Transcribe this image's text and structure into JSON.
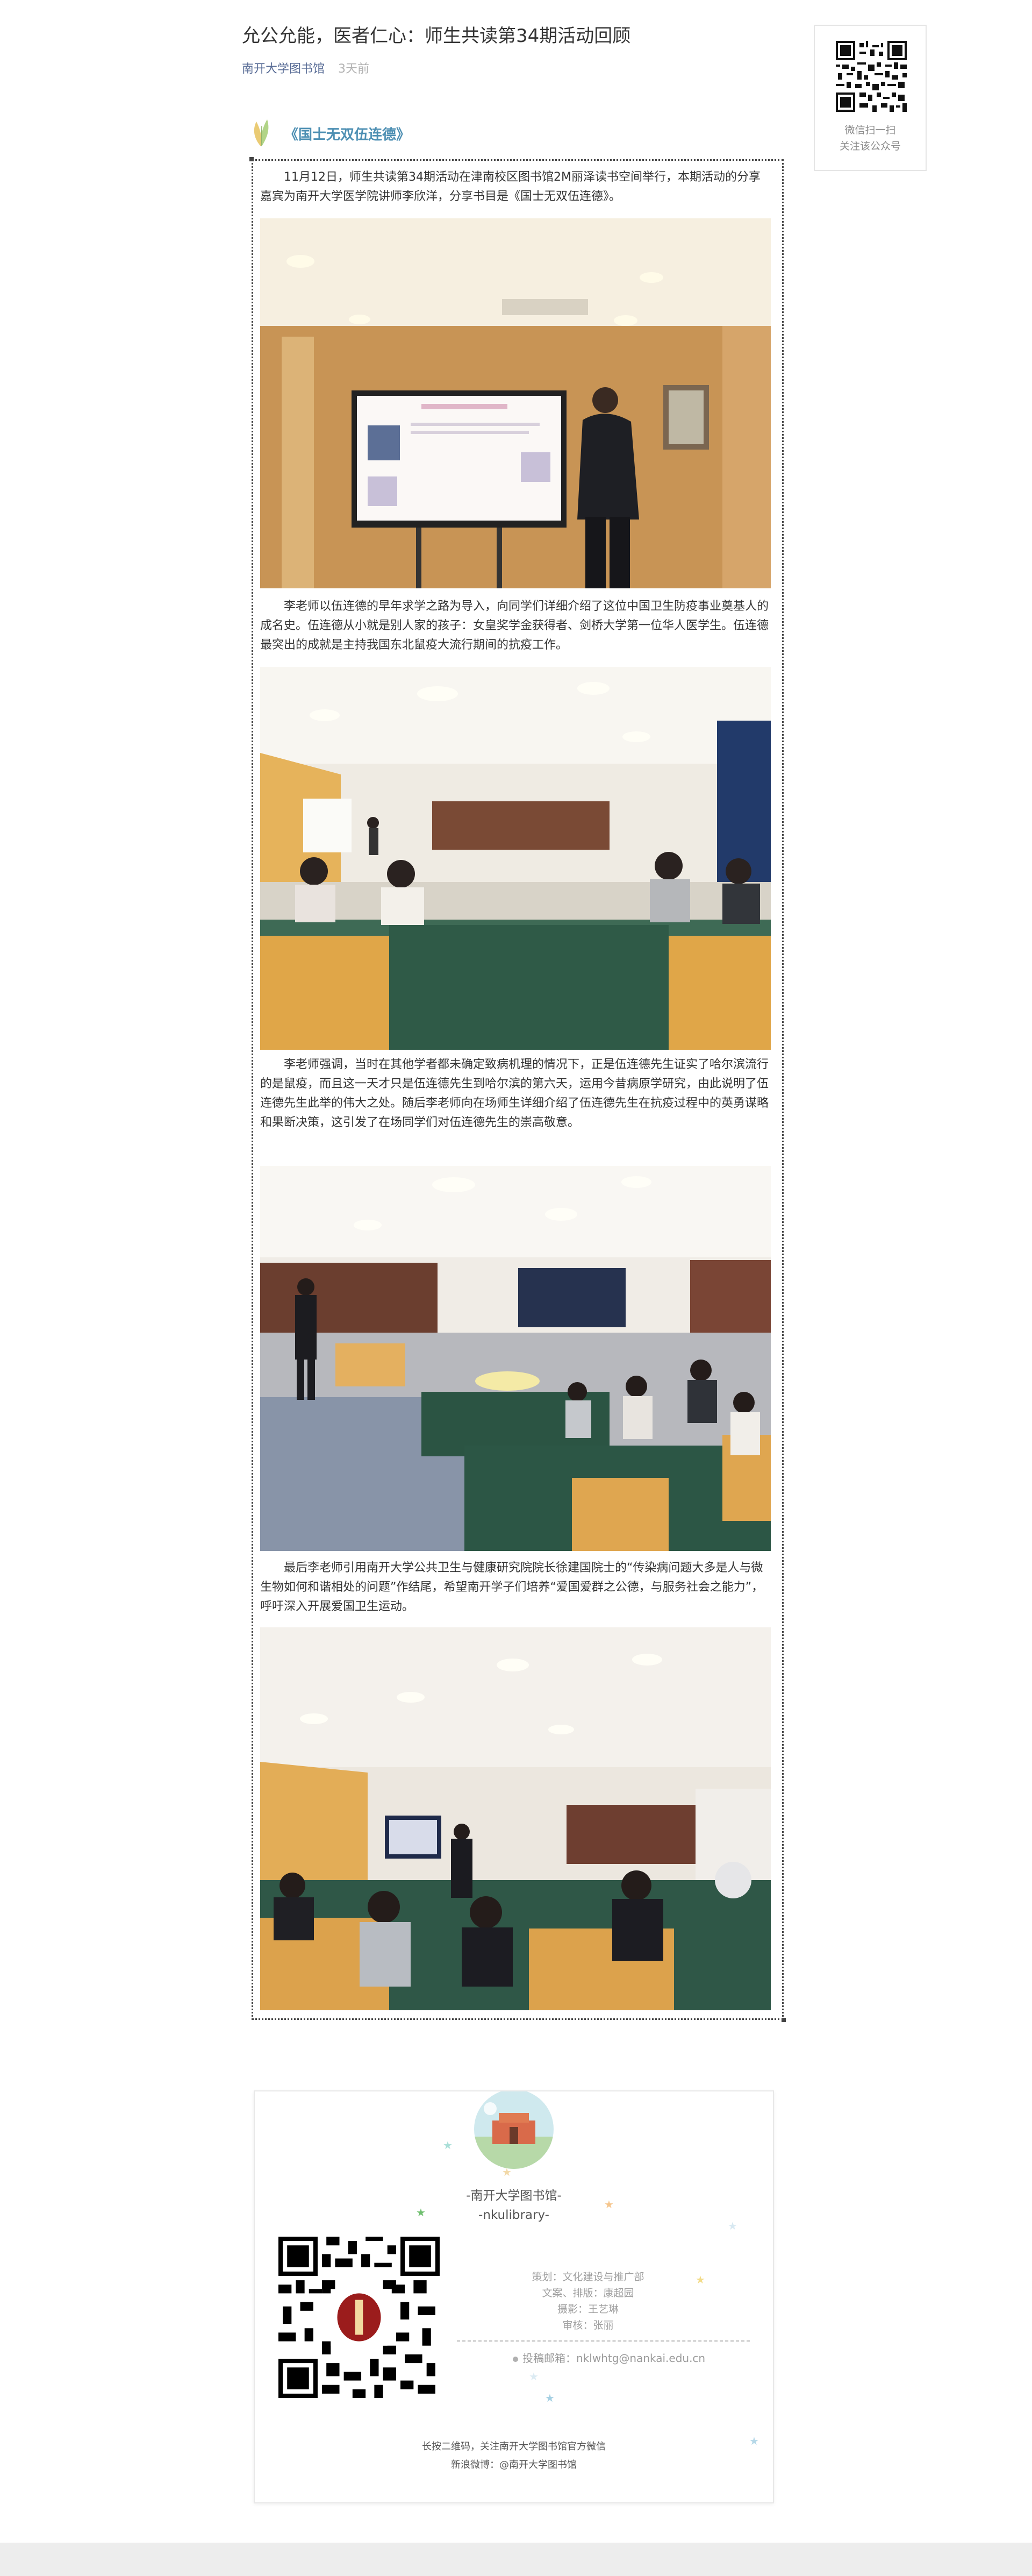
{
  "article": {
    "title": "允公允能，医者仁心：师生共读第34期活动回顾",
    "author": "南开大学图书馆",
    "time": "3天前"
  },
  "sidebar_qr": {
    "line1": "微信扫一扫",
    "line2": "关注该公众号"
  },
  "section": {
    "title": "《国士无双伍连德》"
  },
  "paragraphs": [
    "11月12日，师生共读第34期活动在津南校区图书馆2M丽泽读书空间举行，本期活动的分享嘉宾为南开大学医学院讲师李欣洋，分享书目是《国士无双伍连德》。",
    "李老师以伍连德的早年求学之路为导入，向同学们详细介绍了这位中国卫生防疫事业奠基人的成名史。伍连德从小就是别人家的孩子：女皇奖学金获得者、剑桥大学第一位华人医学生。伍连德最突出的成就是主持我国东北鼠疫大流行期间的抗疫工作。",
    "李老师强调，当时在其他学者都未确定致病机理的情况下，正是伍连德先生证实了哈尔滨流行的是鼠疫，而且这一天才只是伍连德先生到哈尔滨的第六天，运用今昔病原学研究，由此说明了伍连德先生此举的伟大之处。随后李老师向在场师生详细介绍了伍连德先生在抗疫过程中的英勇谋略和果断决策，这引发了在场同学们对伍连德先生的崇高敬意。",
    "最后李老师引用南开大学公共卫生与健康研究院院长徐建国院士的“传染病问题大多是人与微生物如何和谐相处的问题”作结尾，希望南开学子们培养“爱国爱群之公德，与服务社会之能力”，呼吁深入开展爱国卫生运动。"
  ],
  "footer": {
    "brand_cn": "-南开大学图书馆-",
    "brand_en": "-nkulibrary-",
    "credits": [
      "策划：文化建设与推广部",
      "文案、排版：康超园",
      "摄影：王艺琳",
      "审核：张丽"
    ],
    "email": "投稿邮箱：nklwhtg@nankai.edu.cn",
    "note1": "长按二维码，关注南开大学图书馆官方微信",
    "note2": "新浪微博：@南开大学图书馆"
  },
  "colors": {
    "link": "#576b95",
    "section_title": "#4d8fb3",
    "body_text": "#333333"
  }
}
